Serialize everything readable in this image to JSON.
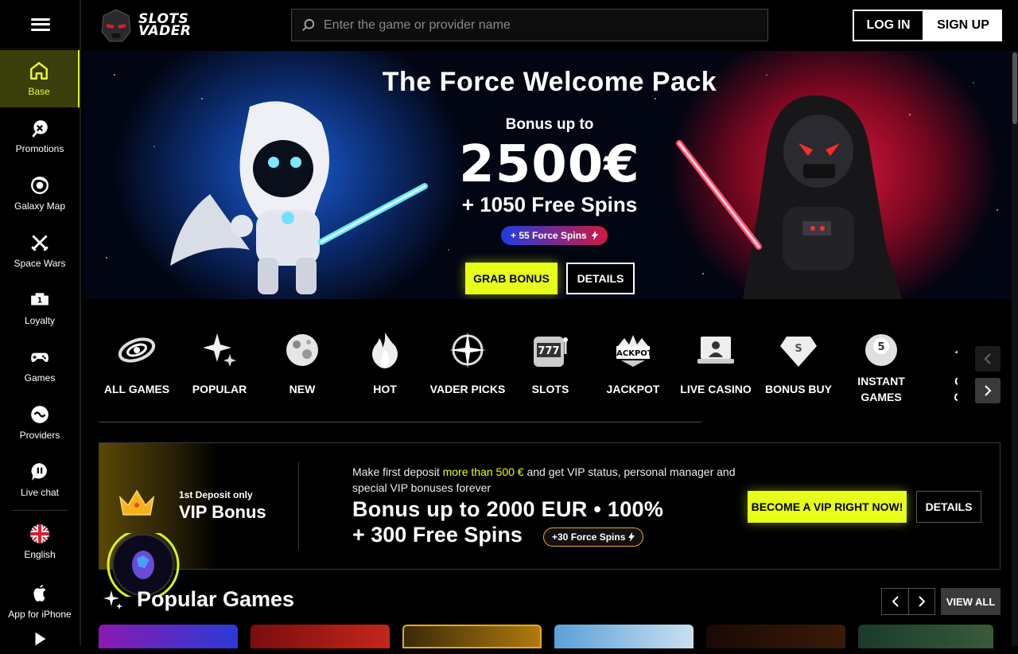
{
  "brand": {
    "line1": "SLOTS",
    "line2": "VADER"
  },
  "search": {
    "placeholder": "Enter the game or provider name"
  },
  "auth": {
    "login": "LOG IN",
    "signup": "SIGN UP"
  },
  "sidebar": {
    "items": [
      {
        "label": "Base",
        "icon": "home-icon",
        "active": true
      },
      {
        "label": "Promotions",
        "icon": "promotions-icon"
      },
      {
        "label": "Galaxy Map",
        "icon": "galaxy-map-icon"
      },
      {
        "label": "Space Wars",
        "icon": "crossed-swords-icon"
      },
      {
        "label": "Loyalty",
        "icon": "loyalty-icon"
      },
      {
        "label": "Games",
        "icon": "gamepad-icon"
      },
      {
        "label": "Providers",
        "icon": "providers-icon"
      },
      {
        "label": "Live chat",
        "icon": "chat-icon"
      }
    ],
    "language": "English",
    "app": "App for iPhone"
  },
  "hero": {
    "title": "The Force Welcome Pack",
    "subtitle": "Bonus up to",
    "amount": "2500€",
    "spins": "+ 1050 Free Spins",
    "force_pill": "+ 55 Force Spins",
    "grab": "GRAB BONUS",
    "details": "DETAILS"
  },
  "categories": [
    {
      "label": "ALL GAMES",
      "icon": "galaxy-icon"
    },
    {
      "label": "POPULAR",
      "icon": "sparkle-icon"
    },
    {
      "label": "NEW",
      "icon": "planet-icon"
    },
    {
      "label": "HOT",
      "icon": "flame-icon"
    },
    {
      "label": "VADER PICKS",
      "icon": "compass-star-icon"
    },
    {
      "label": "SLOTS",
      "icon": "slot-machine-icon"
    },
    {
      "label": "JACKPOT",
      "icon": "jackpot-icon"
    },
    {
      "label": "LIVE CASINO",
      "icon": "live-casino-icon"
    },
    {
      "label": "BONUS BUY",
      "icon": "diamond-icon"
    },
    {
      "label": "INSTANT GAMES",
      "icon": "ball-icon"
    },
    {
      "label": "CRASH GAMES",
      "icon": "crash-icon"
    }
  ],
  "vip": {
    "first": "1st Deposit only",
    "title": "VIP Bonus",
    "desc_pre": "Make first deposit ",
    "desc_hl": "more than 500 €",
    "desc_post": " and get VIP status, personal manager and special VIP bonuses forever",
    "big1": "Bonus up to 2000 EUR • 100%",
    "big2": "+ 300 Free Spins",
    "pill": "+30 Force Spins",
    "cta": "BECOME A VIP RIGHT NOW!",
    "details": "DETAILS"
  },
  "popular": {
    "title": "Popular Games",
    "view_all": "VIEW ALL"
  },
  "colors": {
    "accent": "#e8ff1a",
    "background": "#000000"
  }
}
